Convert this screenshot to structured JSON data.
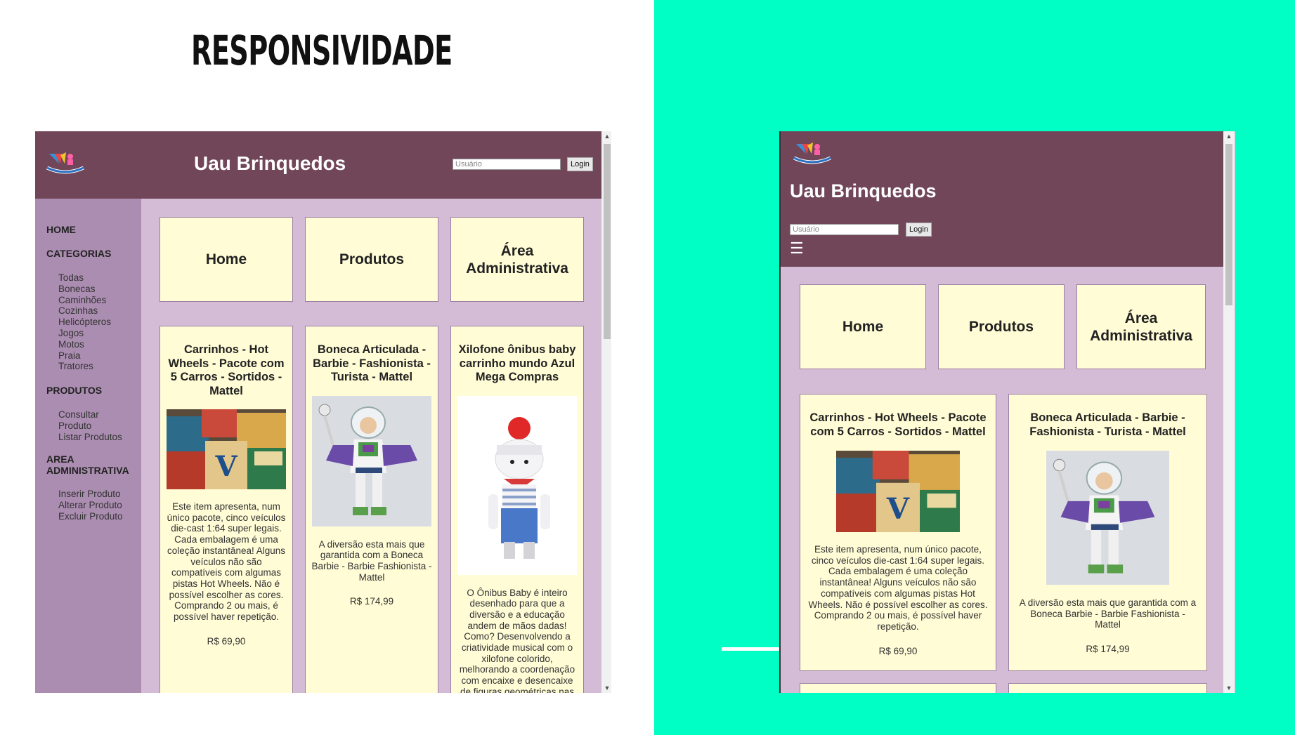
{
  "slide": {
    "title": "RESPONSIVIDADE"
  },
  "site": {
    "title": "Uau Brinquedos",
    "logo_text": "UAU BRINQUEDOS",
    "user_placeholder": "Usuário",
    "login_label": "Login",
    "menu_icon": "☰",
    "scroll_up": "▲",
    "scroll_down": "▼"
  },
  "sidebar": {
    "home": "HOME",
    "categorias": "CATEGORIAS",
    "categories": [
      "Todas",
      "Bonecas",
      "Caminhões",
      "Cozinhas",
      "Helicópteros",
      "Jogos",
      "Motos",
      "Praia",
      "Tratores"
    ],
    "produtos": "PRODUTOS",
    "produtos_items": [
      "Consultar",
      "Produto",
      "Listar Produtos"
    ],
    "area_line1": "AREA",
    "area_line2": "ADMINISTRATIVA",
    "area_items": [
      "Inserir Produto",
      "Alterar Produto",
      "Excluir Produto"
    ]
  },
  "nav_cards": [
    "Home",
    "Produtos",
    "Área Administrativa"
  ],
  "products": [
    {
      "title": "Carrinhos - Hot Wheels - Pacote com 5 Carros - Sortidos - Mattel",
      "description": "Este item apresenta, num único pacote, cinco veículos die-cast 1:64 super legais. Cada embalagem é uma coleção instantânea! Alguns veículos não são compatíveis com algumas pistas Hot Wheels. Não é possível escolher as cores. Comprando 2 ou mais, é possível haver repetição.",
      "price": "R$ 69,90",
      "image_icon": "toy-blocks-photo"
    },
    {
      "title": "Boneca Articulada - Barbie - Fashionista - Turista - Mattel",
      "description": "A diversão esta mais que garantida com a Boneca Barbie - Barbie Fashionista - Mattel",
      "price": "R$ 174,99",
      "image_icon": "buzz-lightyear-photo"
    },
    {
      "title": "Xilofone ônibus baby carrinho mundo Azul Mega Compras",
      "description": "O Ônibus Baby é inteiro desenhado para que a diversão e a educação andem de mãos dadas! Como? Desenvolvendo a criatividade musical com o xilofone colorido, melhorando a coordenação com encaixe e desencaixe de figuras geométricas nas",
      "price": "",
      "image_icon": "knitted-cat-doll-photo"
    }
  ],
  "colors": {
    "header": "#724659",
    "sidebar": "#ab8db1",
    "content": "#d4bbd6",
    "card": "#fffcd6",
    "teal": "#00ffc4"
  }
}
